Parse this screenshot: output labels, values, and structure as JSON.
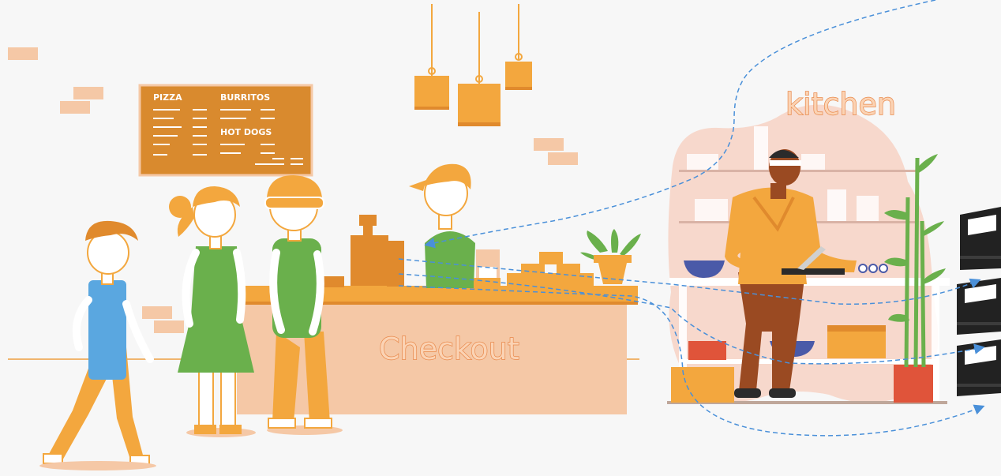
{
  "menu_board": {
    "col1_header": "PIZZA",
    "col2_header": "BURRITOS",
    "col2_subheader": "HOT DOGS"
  },
  "labels": {
    "checkout": "Checkout",
    "kitchen": "kitchen"
  },
  "colors": {
    "orange": "#f5a623",
    "dark_orange": "#e08a2d",
    "menu_board": "#d98a2e",
    "counter_top": "#f3a73e",
    "counter_front": "#f5c8a6",
    "kitchen_blob": "#f7d8cc",
    "green": "#6ab04c",
    "blue": "#5aa7e0",
    "arrow": "#4a90d9",
    "printer": "#222222"
  },
  "icons": [
    "receipt-printer-icon",
    "cash-register-icon"
  ]
}
